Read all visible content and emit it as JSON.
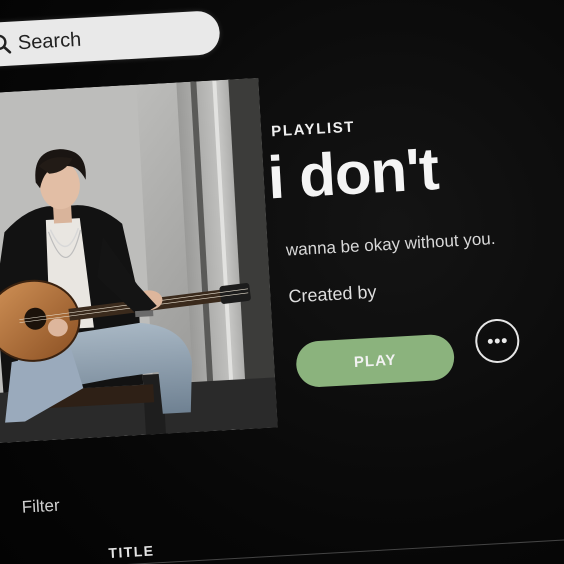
{
  "search": {
    "label": "Search",
    "icon": "search-icon"
  },
  "playlist": {
    "type_label": "PLAYLIST",
    "title": "i don't",
    "description": "wanna be okay without you.",
    "created_by": "Created by",
    "cover_image": "man-playing-acoustic-guitar"
  },
  "actions": {
    "play_label": "PLAY",
    "more_icon": "more-options-icon",
    "accent_color": "#8bb37d"
  },
  "list": {
    "filter_label": "Filter",
    "columns": [
      "TITLE"
    ]
  }
}
